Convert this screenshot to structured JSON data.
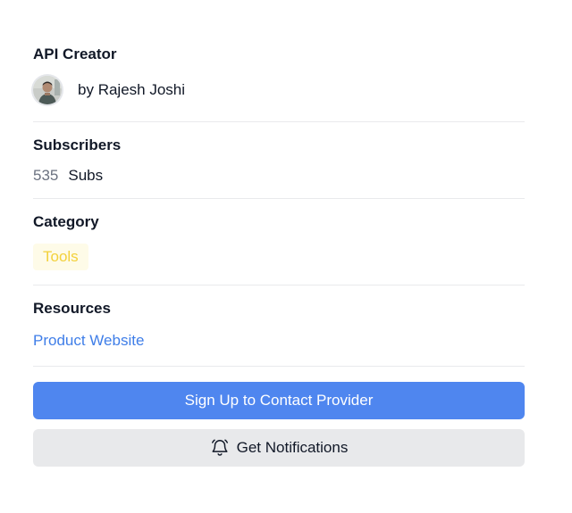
{
  "creator": {
    "heading": "API Creator",
    "by_prefix": "by",
    "name": "Rajesh Joshi",
    "avatar_icon": "user-avatar-photo"
  },
  "subscribers": {
    "heading": "Subscribers",
    "count": "535",
    "unit": "Subs"
  },
  "category": {
    "heading": "Category",
    "tag": "Tools"
  },
  "resources": {
    "heading": "Resources",
    "link": "Product Website"
  },
  "actions": {
    "primary_label": "Sign Up to Contact Provider",
    "secondary_label": "Get Notifications",
    "secondary_icon": "bell-icon"
  },
  "colors": {
    "primary": "#4f86ef",
    "link": "#3f7ee8",
    "tag_text": "#f3d13b",
    "tag_bg": "#fefbe8",
    "secondary_bg": "#e8e9eb"
  }
}
